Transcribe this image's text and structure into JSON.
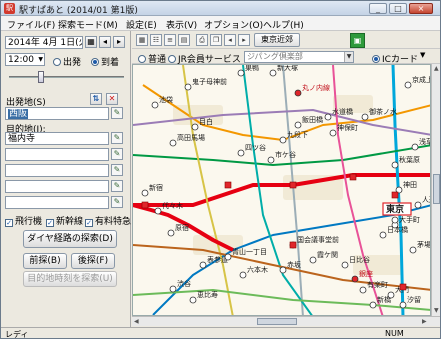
{
  "window": {
    "title": "駅すぱあと (2014/01 第1版)",
    "minimize": "_",
    "maximize": "□",
    "close": "×"
  },
  "menu": [
    "ファイル(F)",
    "探索モード(M)",
    "設定(E)",
    "表示(V)",
    "オプション(O)",
    "ヘルプ(H)"
  ],
  "left": {
    "date": "2014年 4月 1日(火)",
    "time": "12:00",
    "radio_depart": "出発",
    "radio_arrive": "到着",
    "origin_label": "出発地(S)",
    "origin_value": "西阪",
    "dest_label": "目的地(J):",
    "dest_value": "福内寺",
    "filters": [
      "飛行機",
      "新幹線",
      "有料特急"
    ],
    "search_button": "ダイヤ経路の探索(D)",
    "next_button": "前探(B)",
    "later_button": "後探(F)",
    "disabled_button": "目的地時刻を探索(U)"
  },
  "toolbar": {
    "zoom_label": "東京近郊",
    "icons": [
      "grid-icon",
      "table-icon",
      "list-icon",
      "map-icon",
      "print-icon",
      "copy-icon",
      "back-icon",
      "forward-icon"
    ]
  },
  "filterbar": {
    "fare_normal": "普通",
    "fare_jr": "JR会員サービス",
    "line_select": "ジパング倶楽部",
    "ic_card": "ICカード"
  },
  "map": {
    "stations": [
      {
        "name": "巣鴨",
        "style": "normal"
      },
      {
        "name": "新大塚",
        "style": "normal"
      },
      {
        "name": "鬼子母神前",
        "style": "normal"
      },
      {
        "name": "丸ノ内線",
        "style": "red"
      },
      {
        "name": "水道橋",
        "style": "normal"
      },
      {
        "name": "御茶ノ水",
        "style": "normal"
      },
      {
        "name": "四ツ谷",
        "style": "normal"
      },
      {
        "name": "市ケ谷",
        "style": "normal"
      },
      {
        "name": "新宿",
        "style": "normal"
      },
      {
        "name": "代々木",
        "style": "normal"
      },
      {
        "name": "原宿",
        "style": "normal"
      },
      {
        "name": "渋谷",
        "style": "normal"
      },
      {
        "name": "恵比寿",
        "style": "normal"
      },
      {
        "name": "六本木",
        "style": "normal"
      },
      {
        "name": "赤坂",
        "style": "normal"
      },
      {
        "name": "有楽町",
        "style": "normal"
      },
      {
        "name": "新橋",
        "style": "normal"
      },
      {
        "name": "大手町",
        "style": "normal"
      },
      {
        "name": "神田",
        "style": "normal"
      },
      {
        "name": "秋葉原",
        "style": "normal"
      },
      {
        "name": "浅草橋",
        "style": "normal"
      },
      {
        "name": "高田馬場",
        "style": "normal"
      },
      {
        "name": "目白",
        "style": "normal"
      },
      {
        "name": "池袋",
        "style": "normal"
      },
      {
        "name": "飯田橋",
        "style": "normal"
      },
      {
        "name": "神保町",
        "style": "normal"
      },
      {
        "name": "九段下",
        "style": "normal"
      },
      {
        "name": "霞ケ関",
        "style": "normal"
      },
      {
        "name": "日比谷",
        "style": "normal"
      },
      {
        "name": "大門",
        "style": "normal"
      },
      {
        "name": "汐留",
        "style": "normal"
      },
      {
        "name": "表参道",
        "style": "normal"
      },
      {
        "name": "青山一丁目",
        "style": "normal"
      },
      {
        "name": "国会議事堂前",
        "style": "normal"
      },
      {
        "name": "銀座",
        "style": "red"
      },
      {
        "name": "東京",
        "style": "boxed"
      },
      {
        "name": "京成上野",
        "style": "normal"
      },
      {
        "name": "日本橋",
        "style": "normal"
      },
      {
        "name": "人形町",
        "style": "normal"
      },
      {
        "name": "茅場町",
        "style": "normal"
      }
    ],
    "line_colors": [
      "#e60012",
      "#f39700",
      "#0079c2",
      "#9caeb7",
      "#00a7db",
      "#009944",
      "#d7c447",
      "#9b7cb6",
      "#00ada9",
      "#bb641d",
      "#e85298",
      "#6cbb5a"
    ]
  },
  "status": {
    "left": "レディ",
    "right": "NUM"
  }
}
